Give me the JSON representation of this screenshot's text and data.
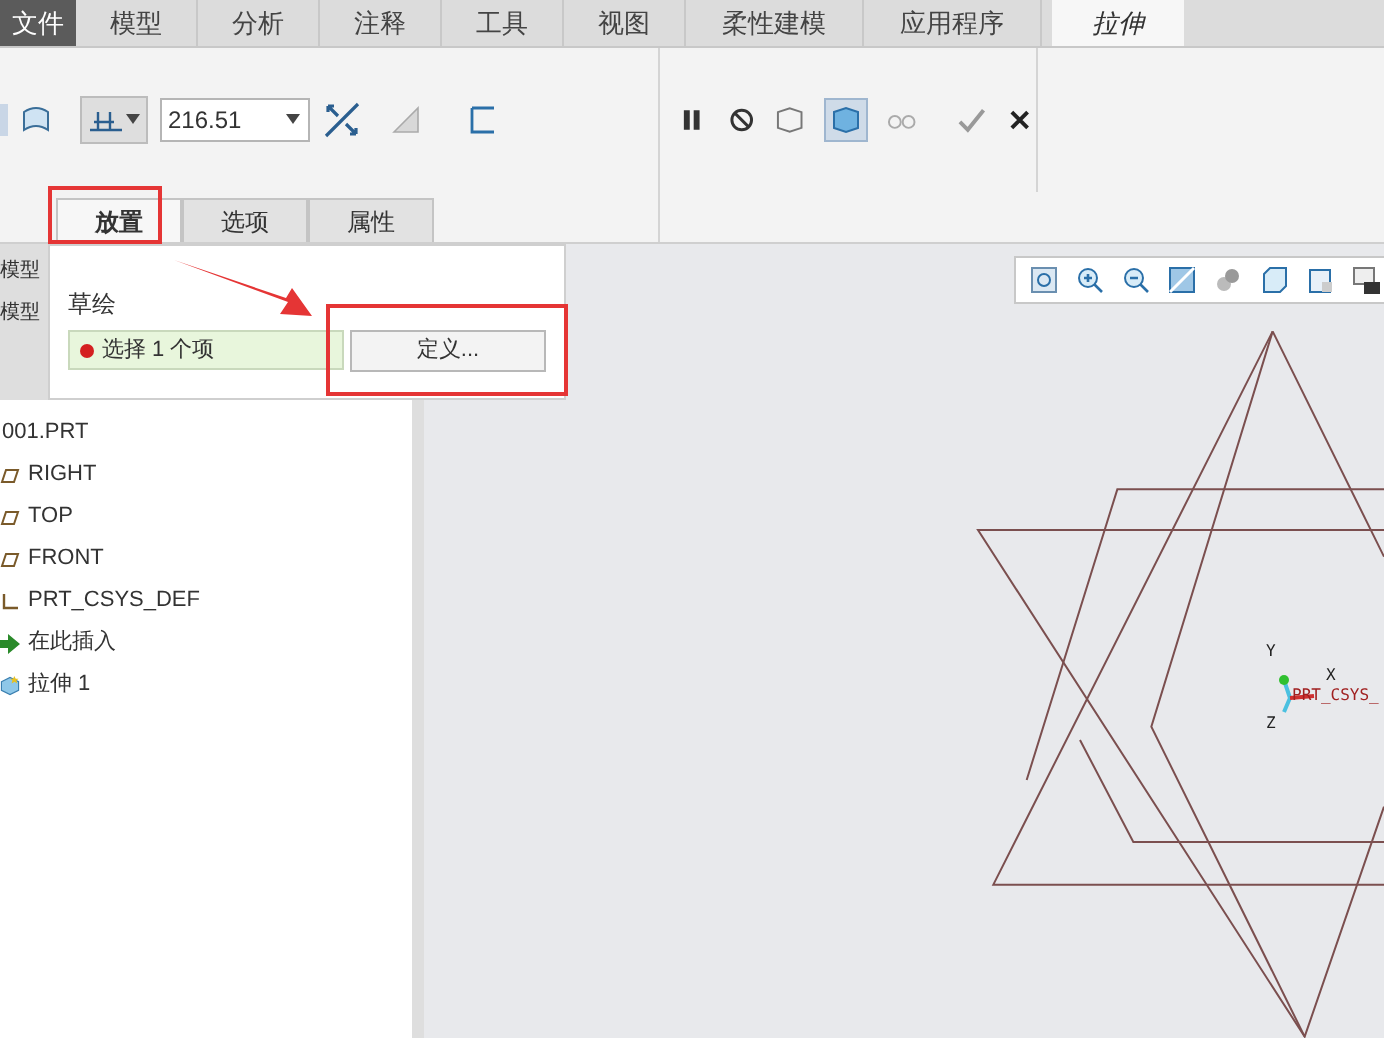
{
  "ribbon_tabs": [
    {
      "label": "文件",
      "kind": "file",
      "selected": false
    },
    {
      "label": "模型",
      "kind": "tab",
      "selected": false
    },
    {
      "label": "分析",
      "kind": "tab",
      "selected": false
    },
    {
      "label": "注释",
      "kind": "tab",
      "selected": false
    },
    {
      "label": "工具",
      "kind": "tab",
      "selected": false
    },
    {
      "label": "视图",
      "kind": "tab",
      "selected": false
    },
    {
      "label": "柔性建模",
      "kind": "tab",
      "selected": false
    },
    {
      "label": "应用程序",
      "kind": "tab",
      "selected": false
    },
    {
      "label": "拉伸",
      "kind": "tab",
      "selected": true
    }
  ],
  "toolbar": {
    "depth_value": "216.51"
  },
  "dashboard_tabs": [
    {
      "label": "放置",
      "selected": true
    },
    {
      "label": "选项",
      "selected": false
    },
    {
      "label": "属性",
      "selected": false
    }
  ],
  "placement_panel": {
    "section_label": "草绘",
    "collector": "选择 1 个项",
    "define_button": "定义..."
  },
  "model_tree_tabs": [
    "模型",
    "模型"
  ],
  "model_tree": {
    "root": "001.PRT",
    "children": [
      {
        "label": "RIGHT",
        "kind": "plane"
      },
      {
        "label": "TOP",
        "kind": "plane"
      },
      {
        "label": "FRONT",
        "kind": "plane"
      },
      {
        "label": "PRT_CSYS_DEF",
        "kind": "csys"
      },
      {
        "label": "在此插入",
        "kind": "insert"
      },
      {
        "label": "拉伸 1",
        "kind": "extrude"
      }
    ]
  },
  "canvas": {
    "axis_y": "Y",
    "axis_x": "X",
    "axis_z": "Z",
    "csys_label": "PRT_CSYS_"
  }
}
